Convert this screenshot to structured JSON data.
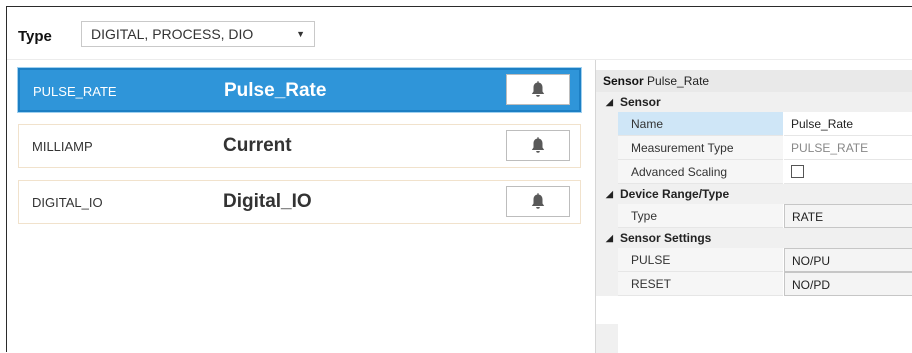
{
  "filter": {
    "label": "Type",
    "selected": "DIGITAL, PROCESS, DIO"
  },
  "sensors": [
    {
      "code": "PULSE_RATE",
      "name": "Pulse_Rate",
      "selected": true
    },
    {
      "code": "MILLIAMP",
      "name": "Current",
      "selected": false
    },
    {
      "code": "DIGITAL_IO",
      "name": "Digital_IO",
      "selected": false
    }
  ],
  "properties": {
    "header_label": "Sensor",
    "header_name": "Pulse_Rate",
    "categories": [
      {
        "label": "Sensor",
        "rows": [
          {
            "name": "Name",
            "value": "Pulse_Rate"
          },
          {
            "name": "Measurement Type",
            "value": "PULSE_RATE"
          },
          {
            "name": "Advanced Scaling",
            "value": "",
            "checked": false
          }
        ]
      },
      {
        "label": "Device Range/Type",
        "rows": [
          {
            "name": "Type",
            "value": "RATE"
          }
        ]
      },
      {
        "label": "Sensor Settings",
        "rows": [
          {
            "name": "PULSE",
            "value": "NO/PU"
          },
          {
            "name": "RESET",
            "value": "NO/PD"
          }
        ]
      }
    ]
  },
  "icons": {
    "alarm": "bell-icon",
    "dropdown": "caret-down-icon",
    "expander": "collapse-triangle-icon"
  },
  "colors": {
    "selection": "#2f95d9",
    "selected_property": "#cfe6f7",
    "row_border": "#f1e2cc"
  }
}
